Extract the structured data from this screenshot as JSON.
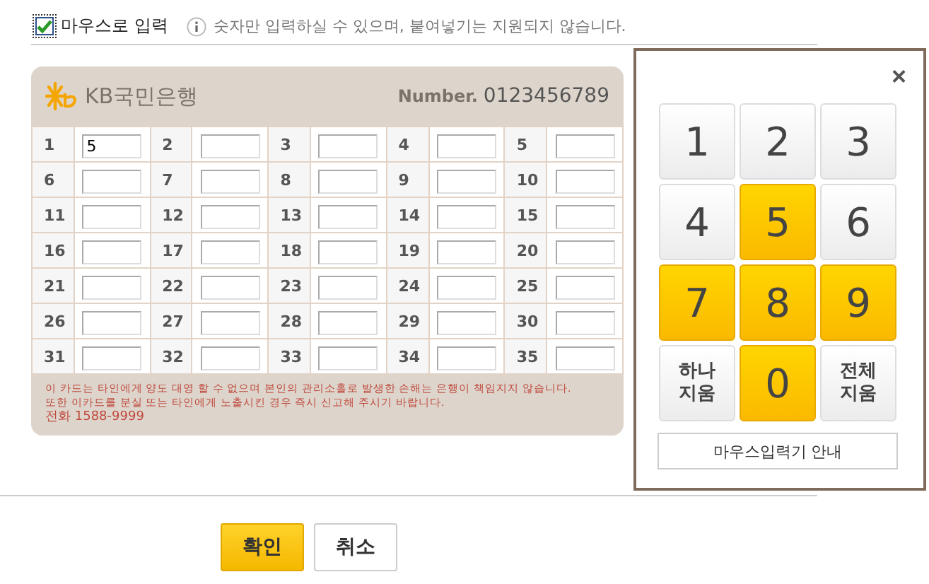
{
  "mouse_input": {
    "label": "마우스로 입력",
    "checked": true
  },
  "notice": "숫자만 입력하실 수 있으며, 붙여넣기는 지원되지 않습니다.",
  "card": {
    "bank": "KB국민은행",
    "number_label": "Number.",
    "number": "0123456789",
    "cells": [
      {
        "label": "1",
        "value": "5"
      },
      {
        "label": "2"
      },
      {
        "label": "3"
      },
      {
        "label": "4"
      },
      {
        "label": "5"
      },
      {
        "label": "6"
      },
      {
        "label": "7"
      },
      {
        "label": "8"
      },
      {
        "label": "9"
      },
      {
        "label": "10"
      },
      {
        "label": "11"
      },
      {
        "label": "12"
      },
      {
        "label": "13"
      },
      {
        "label": "14"
      },
      {
        "label": "15"
      },
      {
        "label": "16"
      },
      {
        "label": "17"
      },
      {
        "label": "18"
      },
      {
        "label": "19"
      },
      {
        "label": "20"
      },
      {
        "label": "21"
      },
      {
        "label": "22"
      },
      {
        "label": "23"
      },
      {
        "label": "24"
      },
      {
        "label": "25"
      },
      {
        "label": "26"
      },
      {
        "label": "27"
      },
      {
        "label": "28"
      },
      {
        "label": "29"
      },
      {
        "label": "30"
      },
      {
        "label": "31"
      },
      {
        "label": "32"
      },
      {
        "label": "33"
      },
      {
        "label": "34"
      },
      {
        "label": "35"
      }
    ],
    "footer": [
      "이 카드는 타인에게 양도 대영 할 수 없으며 본인의 관리소홀로 발생한 손해는 은행이 책임지지 않습니다.",
      "또한 이카드를 분실 또는 타인에게 노출시킨 경우 즉시 신고해 주시기 바랍니다.",
      "전화 1588-9999"
    ]
  },
  "keypad": {
    "close": "×",
    "keys": [
      {
        "label": "1",
        "highlighted": false
      },
      {
        "label": "2",
        "highlighted": false
      },
      {
        "label": "3",
        "highlighted": false
      },
      {
        "label": "4",
        "highlighted": false
      },
      {
        "label": "5",
        "highlighted": true
      },
      {
        "label": "6",
        "highlighted": false
      },
      {
        "label": "7",
        "highlighted": true
      },
      {
        "label": "8",
        "highlighted": true
      },
      {
        "label": "9",
        "highlighted": true
      },
      {
        "label": "하나 지움",
        "highlighted": false,
        "kind": "action"
      },
      {
        "label": "0",
        "highlighted": true
      },
      {
        "label": "전체 지움",
        "highlighted": false,
        "kind": "action"
      }
    ],
    "guide": "마우스입력기 안내"
  },
  "buttons": [
    {
      "label": "확인",
      "kind": "primary"
    },
    {
      "label": "취소",
      "kind": "secondary"
    }
  ]
}
